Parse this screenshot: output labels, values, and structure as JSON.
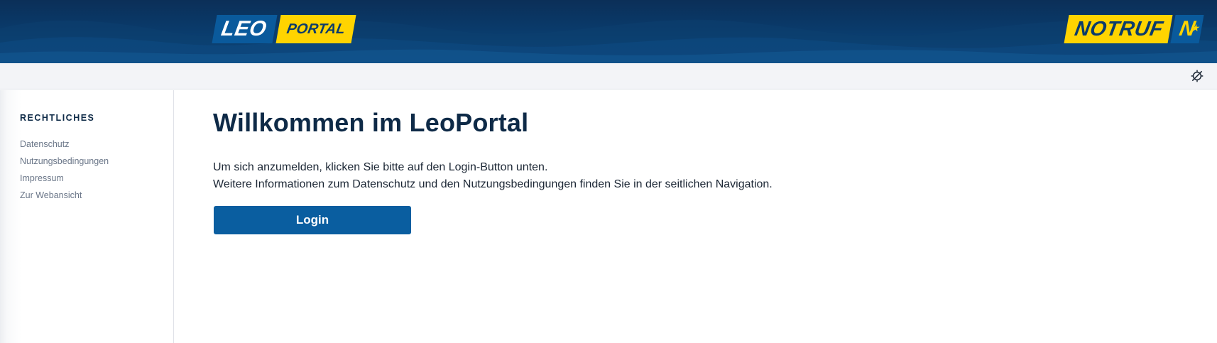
{
  "header": {
    "logo_left": {
      "word1": "LEO",
      "word2": "PORTAL"
    },
    "logo_right": {
      "word": "NOTRUF",
      "mark": "N"
    },
    "colors": {
      "navy": "#0b2f58",
      "blue": "#0a5a9c",
      "yellow": "#ffd400"
    }
  },
  "toolbar": {
    "icon": "no-geolocation-icon"
  },
  "sidebar": {
    "section_title": "RECHTLICHES",
    "items": [
      {
        "label": "Datenschutz"
      },
      {
        "label": "Nutzungsbedingungen"
      },
      {
        "label": "Impressum"
      },
      {
        "label": "Zur Webansicht"
      }
    ]
  },
  "main": {
    "title": "Willkommen im LeoPortal",
    "line1": "Um sich anzumelden, klicken Sie bitte auf den Login-Button unten.",
    "line2": "Weitere Informationen zum Datenschutz und den Nutzungsbedingungen finden Sie in der seitlichen Navigation.",
    "login_label": "Login"
  }
}
